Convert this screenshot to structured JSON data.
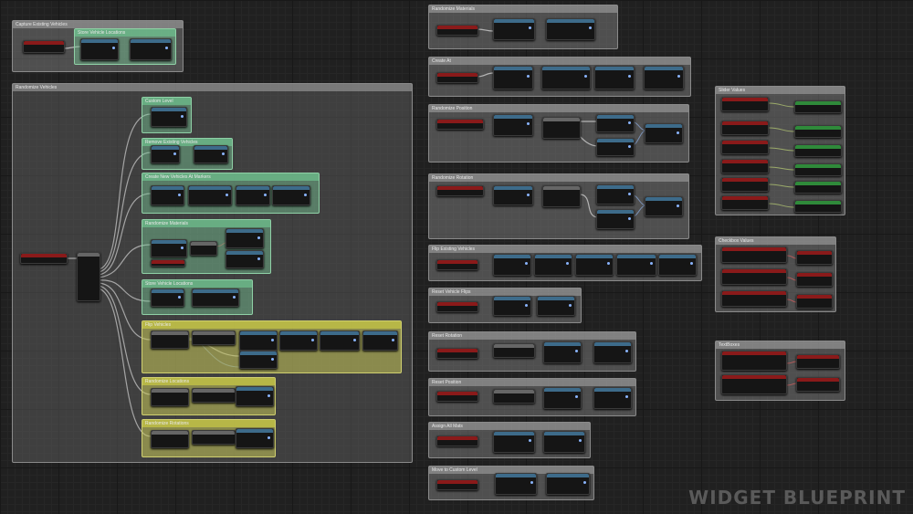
{
  "comments": {
    "c1": "Capture Existing Vehicles",
    "c1a": "Store Vehicle Locations",
    "c2": "Randomize Vehicles",
    "c2a": "Custom Level",
    "c2b": "Remove Existing Vehicles",
    "c2c": "Create New Vehicles At Markers",
    "c2d": "Randomize Materials",
    "c2e": "Store Vehicle Locations",
    "c2f": "Flip Vehicles",
    "c2g": "Randomize Locations",
    "c2h": "Randomize Rotations",
    "r1": "Randomize Materials",
    "r2": "Create At",
    "r3": "Randomize Position",
    "r4": "Randomize Rotation",
    "r5": "Flip Existing Vehicles",
    "r6": "Reset Vehicle Flips",
    "r7": "Reset Rotation",
    "r8": "Reset Position",
    "r9": "Assign All Mats",
    "r10": "Move to Custom Level",
    "s1": "Slider Values",
    "s2": "Checkbox Values",
    "s3": "TextBoxes"
  },
  "watermark": "WIDGET BLUEPRINT"
}
